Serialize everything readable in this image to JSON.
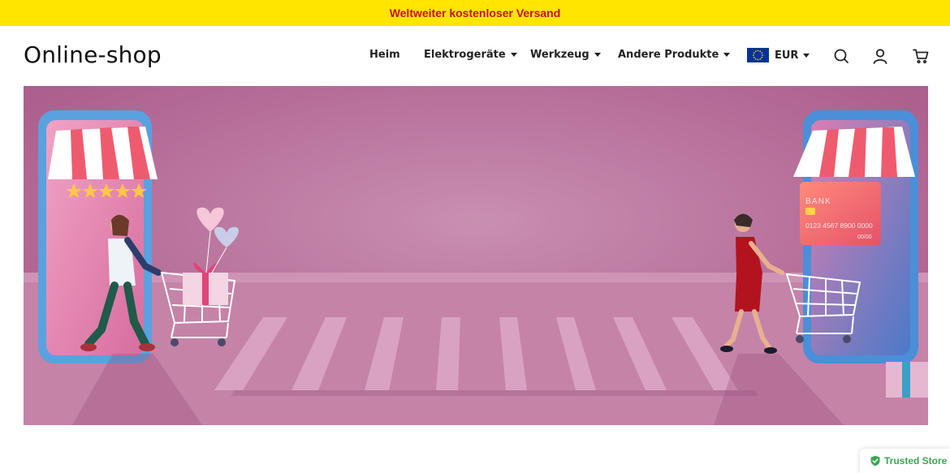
{
  "announcement": {
    "text": "Weltweiter kostenloser Versand"
  },
  "header": {
    "logo": "Online-shop",
    "nav": [
      {
        "label": "Heim",
        "has_dropdown": false
      },
      {
        "label": "Elektrogeräte",
        "has_dropdown": true
      },
      {
        "label": "Werkzeug",
        "has_dropdown": true
      },
      {
        "label": "Andere Produkte",
        "has_dropdown": true
      }
    ],
    "currency": {
      "label": "EUR",
      "flag": "eu-flag-icon"
    },
    "icons": [
      "search-icon",
      "user-icon",
      "cart-icon"
    ]
  },
  "banner": {
    "card": {
      "bank": "BANK",
      "number": "0123 4567 8900 0000",
      "expiry": "00/00"
    }
  },
  "trusted_badge": {
    "label": "Trusted Store",
    "icon": "shield-check-icon"
  },
  "colors": {
    "announcement_bg": "#ffe500",
    "announcement_text": "#c8102e",
    "banner_bg": "#b76b98",
    "trusted_green": "#3aa552"
  }
}
